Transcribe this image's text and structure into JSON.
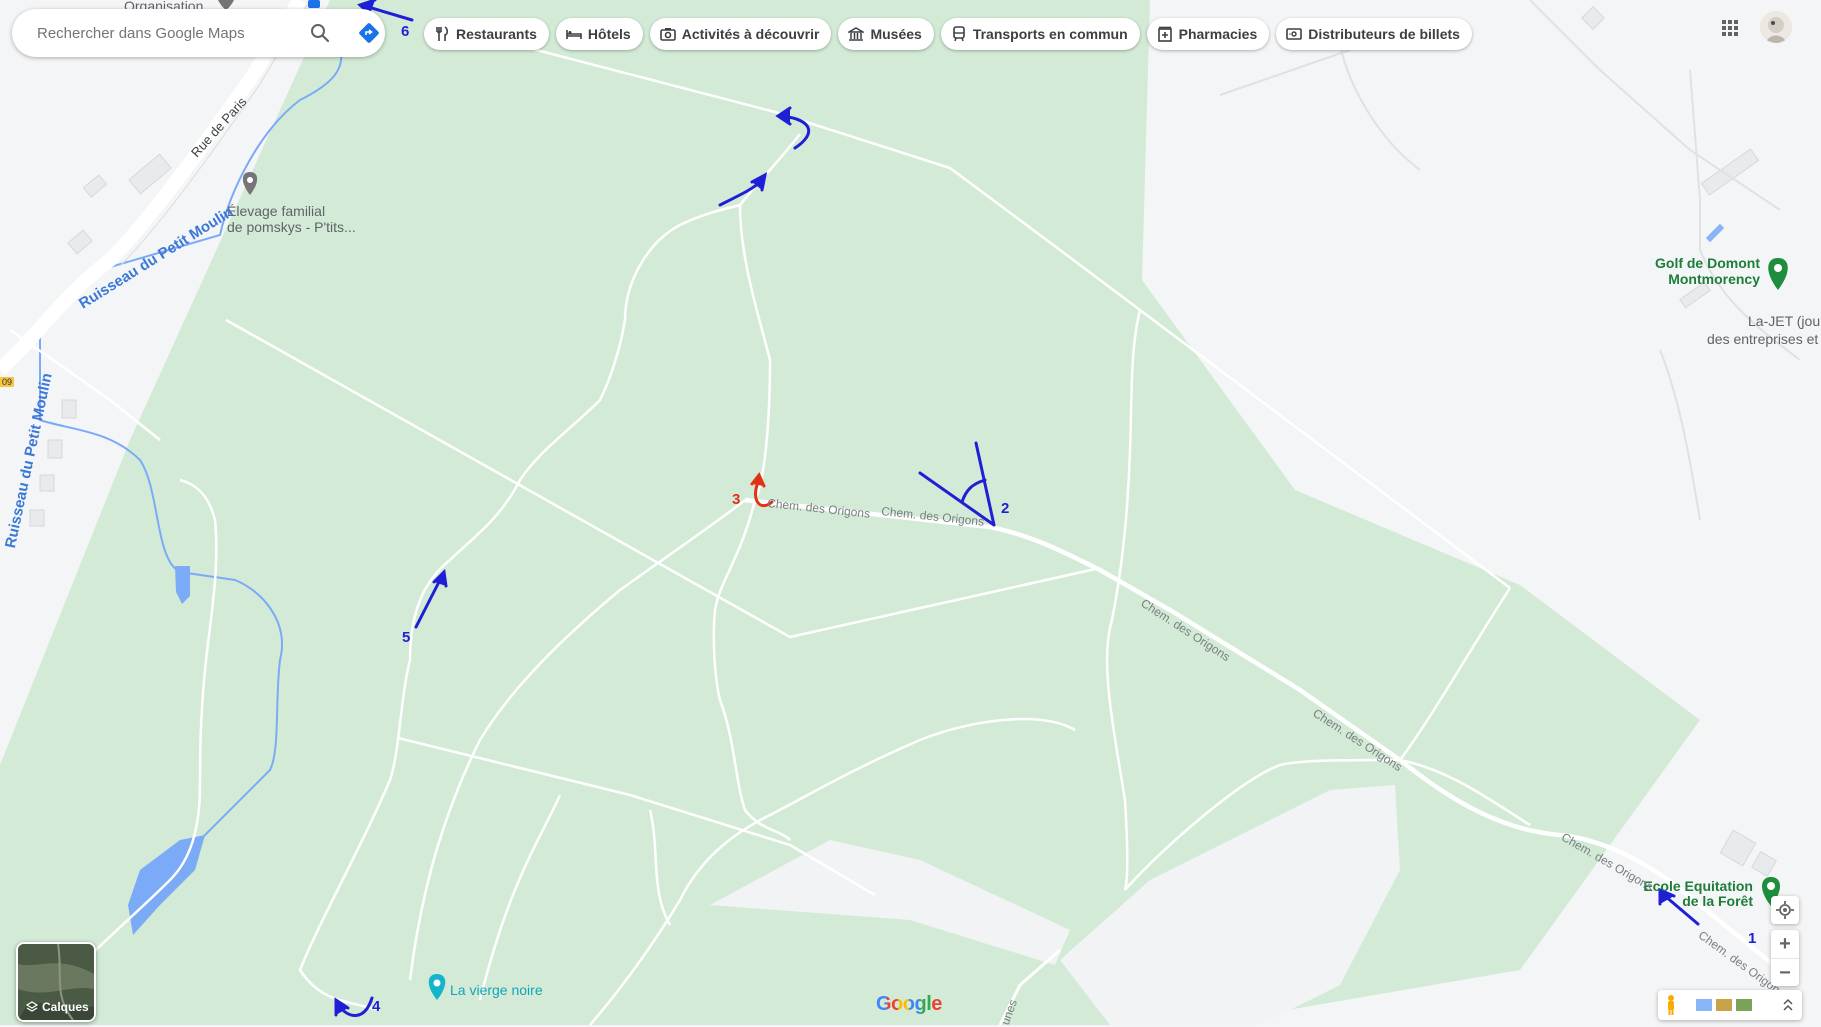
{
  "colors": {
    "forest": "#d3ebd6",
    "background": "#f4f5f6",
    "path": "#ffffff",
    "water": "#7baaf7",
    "annotation_blue": "#1f1fd6",
    "annotation_red": "#e03214",
    "poi_green": "#1e7d3a"
  },
  "search": {
    "placeholder": "Rechercher dans Google Maps"
  },
  "chips": [
    {
      "icon": "fork-knife-icon",
      "label": "Restaurants"
    },
    {
      "icon": "bed-icon",
      "label": "Hôtels"
    },
    {
      "icon": "camera-icon",
      "label": "Activités à découvrir"
    },
    {
      "icon": "museum-icon",
      "label": "Musées"
    },
    {
      "icon": "train-icon",
      "label": "Transports en commun"
    },
    {
      "icon": "pharmacy-icon",
      "label": "Pharmacies"
    },
    {
      "icon": "atm-icon",
      "label": "Distributeurs de billets"
    }
  ],
  "map": {
    "labels": {
      "organisation": "Organisation",
      "rue_de_paris": "Rue de Paris",
      "elevage_line1": "Élevage familial",
      "elevage_line2": "de pomskys - P'tits...",
      "ruisseau_1": "Ruisseau du Petit Moulin",
      "ruisseau_2": "Ruisseau du Petit Moulin",
      "golf_line1": "Golf de Domont",
      "golf_line2": "Montmorency",
      "lajet_line1": "La-JET (jour",
      "lajet_line2": "des entreprises et",
      "ecole_line1": "Ecole Equitation",
      "ecole_line2": "de la Forêt",
      "vierge": "La vierge noire",
      "road_badge": "09",
      "chem_1": "Chem. des Origons",
      "chem_2": "Chem. des Origons",
      "chem_3": "Chem. des Origons",
      "chem_4": "Chem. des Origons",
      "chem_5": "Chem. des Origons",
      "chem_6": "Chem. des Origons",
      "bottom_road": "unes"
    },
    "annotations": [
      "1",
      "2",
      "3",
      "4",
      "5",
      "6"
    ]
  },
  "controls": {
    "layers_label": "Calques",
    "zoom_in": "+",
    "zoom_out": "−",
    "attribution_logo": "Google"
  }
}
